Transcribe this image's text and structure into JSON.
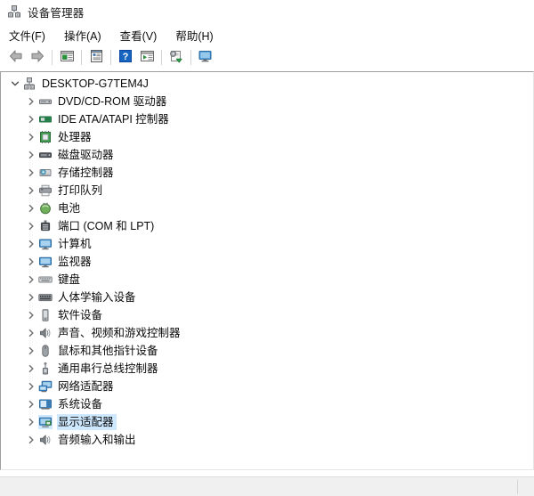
{
  "window": {
    "title": "设备管理器",
    "icon": "device-manager-icon"
  },
  "menubar": {
    "items": [
      {
        "label": "文件(F)",
        "name": "menu-file"
      },
      {
        "label": "操作(A)",
        "name": "menu-action"
      },
      {
        "label": "查看(V)",
        "name": "menu-view"
      },
      {
        "label": "帮助(H)",
        "name": "menu-help"
      }
    ]
  },
  "toolbar": {
    "buttons": [
      {
        "icon": "back-arrow-icon",
        "name": "toolbar-back"
      },
      {
        "icon": "forward-arrow-icon",
        "name": "toolbar-forward"
      },
      {
        "icon": "separator",
        "name": "toolbar-separator-1"
      },
      {
        "icon": "show-hide-console-tree-icon",
        "name": "toolbar-console-tree"
      },
      {
        "icon": "separator",
        "name": "toolbar-separator-2"
      },
      {
        "icon": "properties-icon",
        "name": "toolbar-properties"
      },
      {
        "icon": "separator",
        "name": "toolbar-separator-3"
      },
      {
        "icon": "help-icon",
        "name": "toolbar-help"
      },
      {
        "icon": "update-driver-icon",
        "name": "toolbar-update-driver"
      },
      {
        "icon": "separator",
        "name": "toolbar-separator-4"
      },
      {
        "icon": "scan-hardware-changes-icon",
        "name": "toolbar-scan-hardware"
      },
      {
        "icon": "separator",
        "name": "toolbar-separator-5"
      },
      {
        "icon": "display-device-icon",
        "name": "toolbar-display-device"
      }
    ]
  },
  "tree": {
    "root": {
      "label": "DESKTOP-G7TEM4J",
      "icon": "computer-root-icon",
      "expanded": true
    },
    "nodes": [
      {
        "label": "DVD/CD-ROM 驱动器",
        "icon": "dvd-drive-icon",
        "name": "tree-item-dvd-cdrom"
      },
      {
        "label": "IDE ATA/ATAPI 控制器",
        "icon": "ide-controller-icon",
        "name": "tree-item-ide-ata-atapi"
      },
      {
        "label": "处理器",
        "icon": "processor-icon",
        "name": "tree-item-processor"
      },
      {
        "label": "磁盘驱动器",
        "icon": "disk-drive-icon",
        "name": "tree-item-disk-drive"
      },
      {
        "label": "存储控制器",
        "icon": "storage-controller-icon",
        "name": "tree-item-storage-controller"
      },
      {
        "label": "打印队列",
        "icon": "print-queue-icon",
        "name": "tree-item-print-queue"
      },
      {
        "label": "电池",
        "icon": "battery-icon",
        "name": "tree-item-battery"
      },
      {
        "label": "端口 (COM 和 LPT)",
        "icon": "ports-icon",
        "name": "tree-item-ports"
      },
      {
        "label": "计算机",
        "icon": "computer-icon",
        "name": "tree-item-computer"
      },
      {
        "label": "监视器",
        "icon": "monitor-icon",
        "name": "tree-item-monitor"
      },
      {
        "label": "键盘",
        "icon": "keyboard-icon",
        "name": "tree-item-keyboard"
      },
      {
        "label": "人体学输入设备",
        "icon": "hid-icon",
        "name": "tree-item-hid"
      },
      {
        "label": "软件设备",
        "icon": "software-device-icon",
        "name": "tree-item-software-device"
      },
      {
        "label": "声音、视频和游戏控制器",
        "icon": "sound-video-game-icon",
        "name": "tree-item-sound-video-game"
      },
      {
        "label": "鼠标和其他指针设备",
        "icon": "mouse-icon",
        "name": "tree-item-mouse"
      },
      {
        "label": "通用串行总线控制器",
        "icon": "usb-controller-icon",
        "name": "tree-item-usb-controller"
      },
      {
        "label": "网络适配器",
        "icon": "network-adapter-icon",
        "name": "tree-item-network-adapter"
      },
      {
        "label": "系统设备",
        "icon": "system-device-icon",
        "name": "tree-item-system-device"
      },
      {
        "label": "显示适配器",
        "icon": "display-adapter-icon",
        "name": "tree-item-display-adapter",
        "selected": true
      },
      {
        "label": "音频输入和输出",
        "icon": "audio-io-icon",
        "name": "tree-item-audio-io"
      }
    ]
  },
  "statusbar": {
    "text": ""
  },
  "colors": {
    "selection": "#cde8ff",
    "window_bg": "#ffffff",
    "statusbar_bg": "#f0f0f0",
    "border": "#9f9f9f"
  }
}
